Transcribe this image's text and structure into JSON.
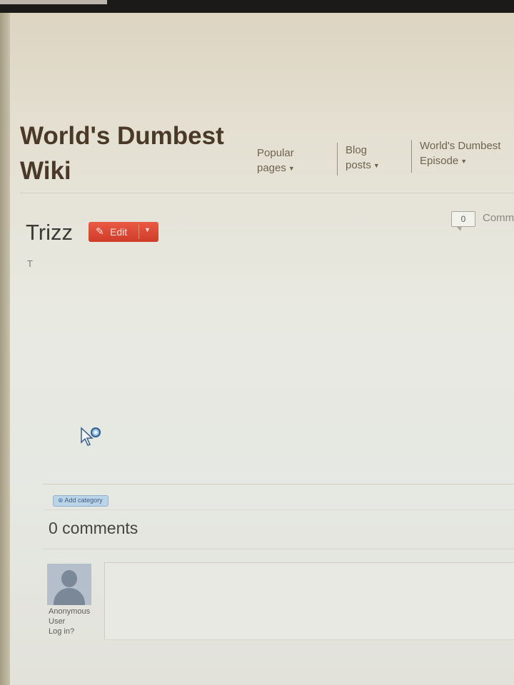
{
  "wiki": {
    "title": "World's Dumbest Wiki"
  },
  "nav": [
    {
      "line1": "Popular",
      "line2": "pages"
    },
    {
      "line1": "Blog",
      "line2": "posts"
    },
    {
      "line1": "World's Dumbest",
      "line2": "Episode"
    }
  ],
  "article": {
    "title": "Trizz",
    "edit_label": "Edit",
    "body_text": "T",
    "comment_count": "0",
    "comments_link_text": "Comments"
  },
  "categories": {
    "add_label": "Add category"
  },
  "comments": {
    "heading": "0 comments",
    "user_line1": "Anonymous",
    "user_line2": "User",
    "login_label": "Log in?"
  },
  "colors": {
    "edit_button": "#d8402c",
    "category_button": "#bcd4e8",
    "title_text": "#4a3828"
  },
  "icons": [
    "pencil-icon",
    "chevron-down-icon",
    "comment-bubble-icon",
    "plus-icon",
    "avatar-icon",
    "mouse-cursor-icon"
  ]
}
